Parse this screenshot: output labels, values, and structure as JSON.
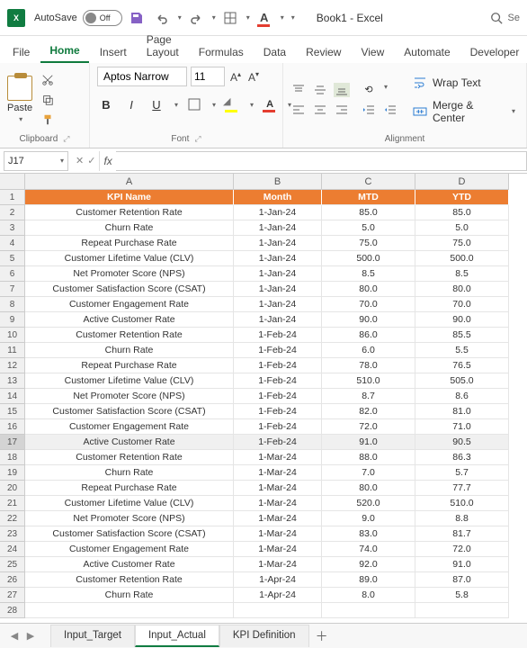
{
  "titlebar": {
    "autosave_label": "AutoSave",
    "autosave_state": "Off",
    "book_title": "Book1 - Excel",
    "search_placeholder": "Se"
  },
  "ribbon_tabs": [
    "File",
    "Home",
    "Insert",
    "Page Layout",
    "Formulas",
    "Data",
    "Review",
    "View",
    "Automate",
    "Developer"
  ],
  "ribbon": {
    "clipboard_label": "Clipboard",
    "paste_label": "Paste",
    "font_label": "Font",
    "font_name": "Aptos Narrow",
    "font_size": "11",
    "alignment_label": "Alignment",
    "wrap_label": "Wrap Text",
    "merge_label": "Merge & Center"
  },
  "formula_bar": {
    "namebox": "J17",
    "fx": "fx"
  },
  "columns": [
    "A",
    "B",
    "C",
    "D"
  ],
  "header_row": [
    "KPI Name",
    "Month",
    "MTD",
    "YTD"
  ],
  "rows": [
    [
      "Customer Retention Rate",
      "1-Jan-24",
      "85.0",
      "85.0"
    ],
    [
      "Churn Rate",
      "1-Jan-24",
      "5.0",
      "5.0"
    ],
    [
      "Repeat Purchase Rate",
      "1-Jan-24",
      "75.0",
      "75.0"
    ],
    [
      "Customer Lifetime Value (CLV)",
      "1-Jan-24",
      "500.0",
      "500.0"
    ],
    [
      "Net Promoter Score (NPS)",
      "1-Jan-24",
      "8.5",
      "8.5"
    ],
    [
      "Customer Satisfaction Score (CSAT)",
      "1-Jan-24",
      "80.0",
      "80.0"
    ],
    [
      "Customer Engagement Rate",
      "1-Jan-24",
      "70.0",
      "70.0"
    ],
    [
      "Active Customer Rate",
      "1-Jan-24",
      "90.0",
      "90.0"
    ],
    [
      "Customer Retention Rate",
      "1-Feb-24",
      "86.0",
      "85.5"
    ],
    [
      "Churn Rate",
      "1-Feb-24",
      "6.0",
      "5.5"
    ],
    [
      "Repeat Purchase Rate",
      "1-Feb-24",
      "78.0",
      "76.5"
    ],
    [
      "Customer Lifetime Value (CLV)",
      "1-Feb-24",
      "510.0",
      "505.0"
    ],
    [
      "Net Promoter Score (NPS)",
      "1-Feb-24",
      "8.7",
      "8.6"
    ],
    [
      "Customer Satisfaction Score (CSAT)",
      "1-Feb-24",
      "82.0",
      "81.0"
    ],
    [
      "Customer Engagement Rate",
      "1-Feb-24",
      "72.0",
      "71.0"
    ],
    [
      "Active Customer Rate",
      "1-Feb-24",
      "91.0",
      "90.5"
    ],
    [
      "Customer Retention Rate",
      "1-Mar-24",
      "88.0",
      "86.3"
    ],
    [
      "Churn Rate",
      "1-Mar-24",
      "7.0",
      "5.7"
    ],
    [
      "Repeat Purchase Rate",
      "1-Mar-24",
      "80.0",
      "77.7"
    ],
    [
      "Customer Lifetime Value (CLV)",
      "1-Mar-24",
      "520.0",
      "510.0"
    ],
    [
      "Net Promoter Score (NPS)",
      "1-Mar-24",
      "9.0",
      "8.8"
    ],
    [
      "Customer Satisfaction Score (CSAT)",
      "1-Mar-24",
      "83.0",
      "81.7"
    ],
    [
      "Customer Engagement Rate",
      "1-Mar-24",
      "74.0",
      "72.0"
    ],
    [
      "Active Customer Rate",
      "1-Mar-24",
      "92.0",
      "91.0"
    ],
    [
      "Customer Retention Rate",
      "1-Apr-24",
      "89.0",
      "87.0"
    ],
    [
      "Churn Rate",
      "1-Apr-24",
      "8.0",
      "5.8"
    ]
  ],
  "sheet_tabs": [
    "Input_Target",
    "Input_Actual",
    "KPI Definition"
  ],
  "active_sheet_index": 1,
  "selected_row_index": 17
}
